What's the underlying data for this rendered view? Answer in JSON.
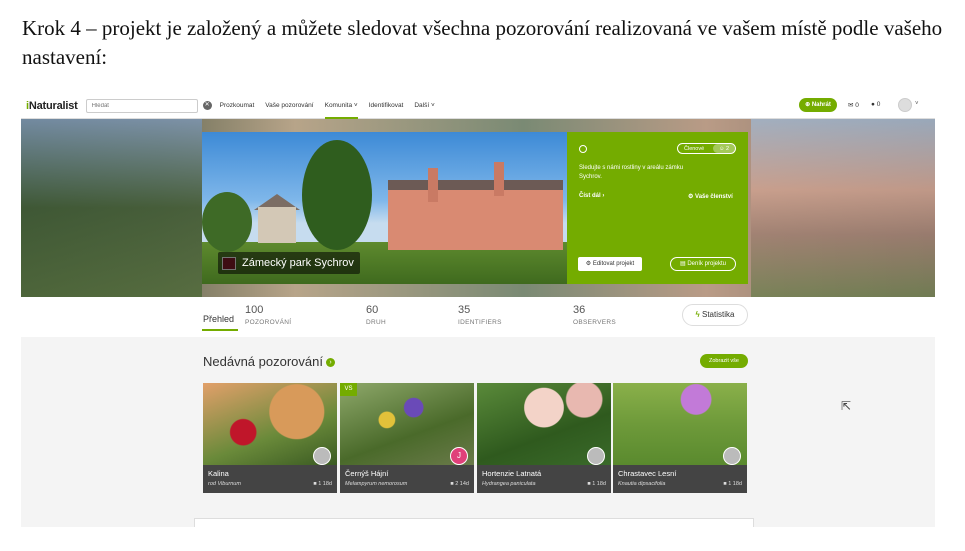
{
  "caption": "Krok 4 – projekt je založený a můžete sledovat všechna pozorování realizovaná ve vašem místě podle vašeho nastavení:",
  "nav": {
    "logo_i": "i",
    "logo_rest": "Naturalist",
    "search_placeholder": "Hledat",
    "links": [
      "Prozkoumat",
      "Vaše pozorování",
      "Komunita ˅",
      "Identifikovat",
      "Další ˅"
    ],
    "upload": "⊕ Nahrát",
    "messages": "✉ 0",
    "notifications": "● 0",
    "caret": "˅"
  },
  "project": {
    "title": "Zámecký park Sychrov",
    "members_label": "Členové",
    "members_count": "☺ 2",
    "description": "Sledujte s námi rostliny v areálu zámku Sychrov.",
    "read_more": "Číst dál ›",
    "membership": "⚙ Vaše členství",
    "edit": "⚙ Editovat projekt",
    "journal": "▤ Deník projektu"
  },
  "stats": {
    "tab": "Přehled",
    "items": [
      {
        "value": "100",
        "label": "POZOROVÁNÍ"
      },
      {
        "value": "60",
        "label": "DRUH"
      },
      {
        "value": "35",
        "label": "IDENTIFIERS"
      },
      {
        "value": "36",
        "label": "OBSERVERS"
      }
    ],
    "button_icon": "ϟ",
    "button": "Statistika"
  },
  "recent": {
    "title": "Nedávná pozorování",
    "icon": "›",
    "show_all": "Zobrazit vše",
    "cards": [
      {
        "name": "Kalina",
        "sci": "rod Viburnum",
        "meta": "■ 1  18d",
        "avatar": ""
      },
      {
        "name": "Černýš Hájní",
        "sci": "Melampyrum nemorosum",
        "meta": "■ 2  14d",
        "avatar": "J",
        "badge": "VS"
      },
      {
        "name": "Hortenzie Latnatá",
        "sci": "Hydrangea paniculata",
        "meta": "■ 1  18d",
        "avatar": ""
      },
      {
        "name": "Chrastavec Lesní",
        "sci": "Knautia dipsacifolia",
        "meta": "■ 1  18d",
        "avatar": ""
      }
    ]
  },
  "colors": {
    "accent": "#74ac00",
    "dark_footer": "#444444"
  }
}
